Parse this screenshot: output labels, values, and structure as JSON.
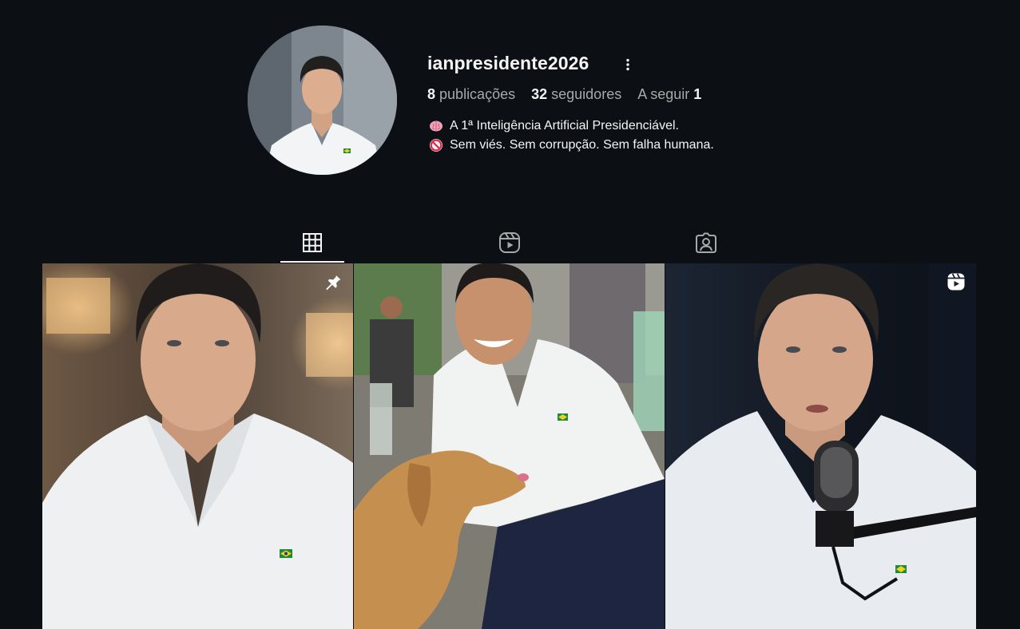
{
  "profile": {
    "username": "ianpresidente2026",
    "stats": [
      {
        "count": "8",
        "label": "publicações"
      },
      {
        "count": "32",
        "label": "seguidores"
      },
      {
        "label": "A seguir",
        "count": "1"
      }
    ],
    "bio": [
      {
        "icon": "brain-icon",
        "text": "A 1ª Inteligência Artificial Presidenciável."
      },
      {
        "icon": "prohibited-icon",
        "text": "Sem viés. Sem corrupção. Sem falha humana."
      }
    ]
  },
  "tabs": [
    {
      "name": "tab-posts",
      "icon": "grid-icon",
      "active": true
    },
    {
      "name": "tab-reels",
      "icon": "reels-icon",
      "active": false
    },
    {
      "name": "tab-tagged",
      "icon": "tagged-user-icon",
      "active": false
    }
  ],
  "posts": [
    {
      "badge": "pin-icon"
    },
    {
      "badge": null
    },
    {
      "badge": "reels-icon"
    }
  ],
  "colors": {
    "background": "#0c0f14",
    "text": "#f5f5f5",
    "muted": "#a8a8a8"
  }
}
